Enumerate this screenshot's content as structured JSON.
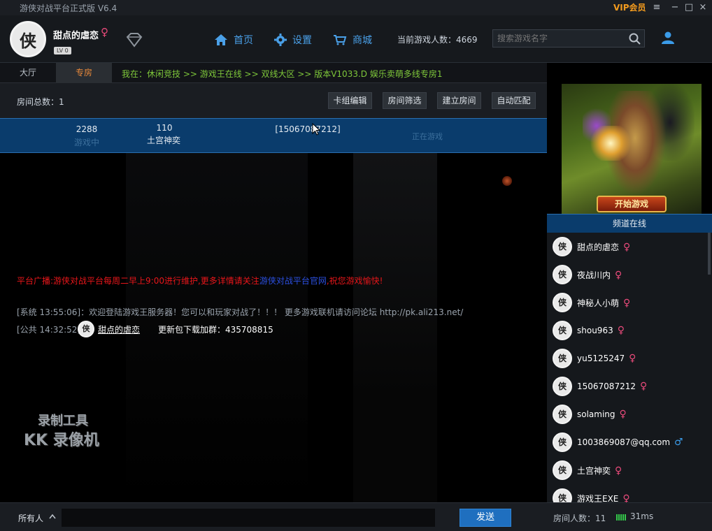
{
  "window": {
    "title": "游侠对战平台正式版 V6.4",
    "vip_label": "VIP会员",
    "menu_icon": "hamburger-icon",
    "minimize_icon": "minimize-icon",
    "maximize_icon": "maximize-icon",
    "close_icon": "close-icon"
  },
  "header": {
    "username": "甜点的虐恋",
    "sex_symbol": "♀",
    "level": "LV 0",
    "avatar_char": "侠",
    "nav": [
      {
        "label": "首页",
        "icon": "home-icon"
      },
      {
        "label": "设置",
        "icon": "gear-icon"
      },
      {
        "label": "商城",
        "icon": "cart-icon"
      }
    ],
    "online_label": "当前游戏人数：4669",
    "search_placeholder": "搜索游戏名字"
  },
  "tabs": [
    {
      "label": "大厅"
    },
    {
      "label": "专房"
    }
  ],
  "breadcrumb": "我在：休闲竞技 >> 游戏王在线 >> 双线大区 >> 版本V1033.D 娱乐卖萌多线专房1",
  "toolbar": {
    "room_total": "房间总数：1",
    "buttons": [
      "卡组编辑",
      "房间筛选",
      "建立房间",
      "自动匹配"
    ]
  },
  "room": {
    "id": "2288",
    "status": "游戏中",
    "players": "110",
    "host": "土宫神奕",
    "name": "[15067087212]",
    "extra": "正在游戏"
  },
  "chat": {
    "broadcast_red": "平台广播:游侠对战平台每周二早上9:00进行维护,更多详情请关注",
    "broadcast_blue": "游侠对战平台官网",
    "broadcast_red2": ",祝您游戏愉快!",
    "system_msg": "[系统 13:55:06]：欢迎登陆游戏王服务器！您可以和玩家对战了！！！ 更多游戏联机请访问论坛 http://pk.ali213.net/",
    "public_time": "[公共 14:32:52]",
    "public_user": "甜点的虐恋",
    "public_avatar_char": "侠",
    "public_body": "更新包下载加群：435708815",
    "watermark_1": "录制工具",
    "watermark_2": "KK 录像机"
  },
  "input": {
    "target": "所有人",
    "send_label": "发送"
  },
  "banner": {
    "start_label": "开始游戏"
  },
  "online_panel": {
    "title": "频道在线",
    "users": [
      {
        "name": "甜点的虐恋",
        "sex": "♀",
        "gender": "female"
      },
      {
        "name": "夜战川内",
        "sex": "♀",
        "gender": "female"
      },
      {
        "name": "神秘人小萌",
        "sex": "♀",
        "gender": "female"
      },
      {
        "name": "shou963",
        "sex": "♀",
        "gender": "female"
      },
      {
        "name": "yu5125247",
        "sex": "♀",
        "gender": "female"
      },
      {
        "name": "15067087212",
        "sex": "♀",
        "gender": "female"
      },
      {
        "name": "solaming",
        "sex": "♀",
        "gender": "female"
      },
      {
        "name": "1003869087@qq.com",
        "sex": "♂",
        "gender": "male"
      },
      {
        "name": "土宫神奕",
        "sex": "♀",
        "gender": "female"
      },
      {
        "name": "游戏王EXE",
        "sex": "♀",
        "gender": "female"
      }
    ]
  },
  "status": {
    "room_count": "房间人数：11",
    "ping": "31ms"
  },
  "colors": {
    "accent_blue": "#0a3c6c",
    "vip_orange": "#f39b1e",
    "breadcrumb_green": "#7ec73a",
    "female_pink": "#e84a7a",
    "male_blue": "#3b9be8",
    "signal_green": "#34c94a"
  }
}
